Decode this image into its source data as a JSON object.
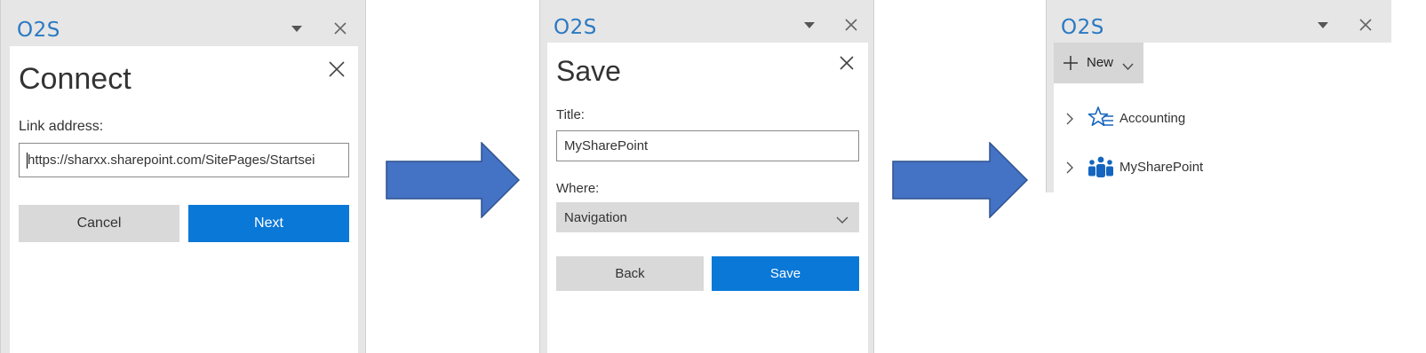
{
  "app_name": "O2S",
  "connect": {
    "heading": "Connect",
    "link_label": "Link address:",
    "link_value": "https://sharxx.sharepoint.com/SitePages/Startsei",
    "cancel_label": "Cancel",
    "next_label": "Next"
  },
  "save": {
    "heading": "Save",
    "title_label": "Title:",
    "title_value": "MySharePoint",
    "where_label": "Where:",
    "where_value": "Navigation",
    "back_label": "Back",
    "save_label": "Save"
  },
  "nav": {
    "new_label": "New",
    "items": [
      {
        "label": "Accounting",
        "icon": "star-list-icon"
      },
      {
        "label": "MySharePoint",
        "icon": "teams-icon"
      }
    ]
  },
  "colors": {
    "accent": "#0a78d7",
    "arrow": "#4472c4",
    "app_title": "#2b79c2"
  }
}
